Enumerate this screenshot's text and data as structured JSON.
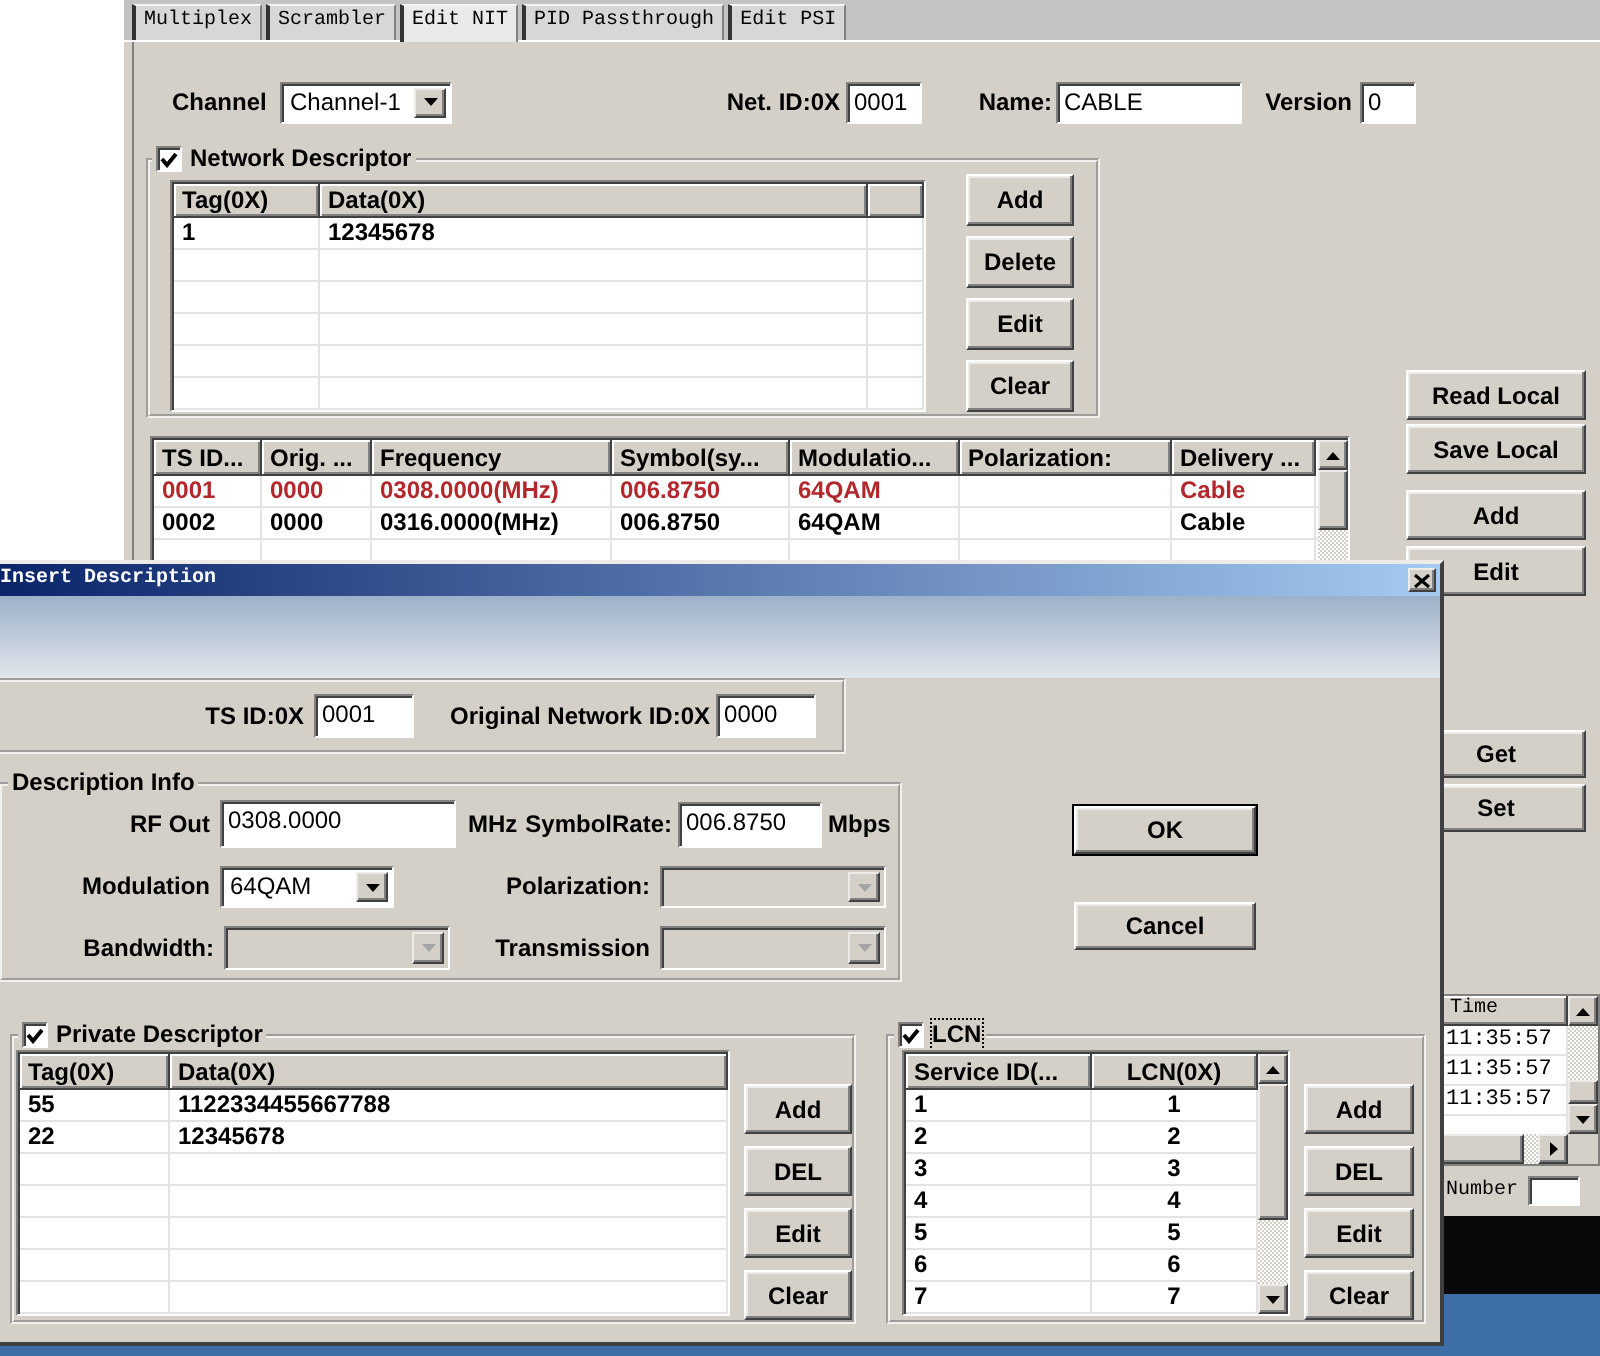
{
  "app": {
    "tabs": [
      {
        "label": "Multiplex",
        "selected": false
      },
      {
        "label": "Scrambler",
        "selected": false
      },
      {
        "label": "Edit NIT",
        "selected": true
      },
      {
        "label": "PID Passthrough",
        "selected": false
      },
      {
        "label": "Edit PSI",
        "selected": false
      }
    ],
    "channel": {
      "label": "Channel",
      "value": "Channel-1"
    },
    "net_id": {
      "label": "Net. ID:0X",
      "value": "0001"
    },
    "name": {
      "label": "Name:",
      "value": "CABLE"
    },
    "version": {
      "label": "Version",
      "value": "0"
    },
    "network_descriptor": {
      "title": "Network Descriptor",
      "checked": true,
      "columns": [
        "Tag(0X)",
        "Data(0X)"
      ],
      "rows": [
        [
          "1",
          "12345678"
        ]
      ],
      "buttons": [
        "Add",
        "Delete",
        "Edit",
        "Clear"
      ]
    },
    "ts_table": {
      "columns": {
        "ts_id": "TS ID...",
        "orig": "Orig. ...",
        "frequency": "Frequency",
        "symbol": "Symbol(sy...",
        "modulation": "Modulatio...",
        "polarization": "Polarization:",
        "delivery": "Delivery ..."
      },
      "rows": [
        {
          "selected": true,
          "cells": {
            "ts_id": "0001",
            "orig": "0000",
            "frequency": "0308.0000(MHz)",
            "symbol": "006.8750",
            "modulation": "64QAM",
            "delivery": "Cable"
          }
        },
        {
          "selected": false,
          "cells": {
            "ts_id": "0002",
            "orig": "0000",
            "frequency": "0316.0000(MHz)",
            "symbol": "006.8750",
            "modulation": "64QAM",
            "delivery": "Cable"
          }
        }
      ]
    },
    "side_buttons": [
      "Read Local",
      "Save Local",
      "Add",
      "Edit",
      "Get",
      "Set"
    ],
    "log_list": {
      "columns": [
        "Time"
      ],
      "rows": [
        [
          "11:35:57"
        ],
        [
          "11:35:57"
        ],
        [
          "11:35:57"
        ]
      ]
    },
    "number": {
      "label": "Number"
    }
  },
  "dialog": {
    "title": "Insert Description",
    "ts_id": {
      "label": "TS ID:0X",
      "value": "0001"
    },
    "original_network_id": {
      "label": "Original Network ID:0X",
      "value": "0000"
    },
    "description_info": {
      "title": "Description Info",
      "rf_out": {
        "label": "RF Out",
        "value": "0308.0000",
        "unit": "MHz"
      },
      "symbol_rate": {
        "label": "SymbolRate:",
        "value": "006.8750",
        "unit": "Mbps"
      },
      "modulation": {
        "label": "Modulation",
        "value": "64QAM",
        "disabled": false
      },
      "polarization": {
        "label": "Polarization:",
        "disabled": true
      },
      "bandwidth": {
        "label": "Bandwidth:",
        "disabled": true
      },
      "transmission": {
        "label": "Transmission",
        "disabled": true
      }
    },
    "buttons": [
      {
        "label": "OK",
        "default": true
      },
      {
        "label": "Cancel",
        "default": false
      }
    ],
    "private_descriptor": {
      "title": "Private Descriptor",
      "checked": true,
      "columns": [
        "Tag(0X)",
        "Data(0X)"
      ],
      "rows": [
        [
          "55",
          "1122334455667788"
        ],
        [
          "22",
          "12345678"
        ]
      ],
      "buttons": [
        "Add",
        "DEL",
        "Edit",
        "Clear"
      ]
    },
    "lcn": {
      "title": "LCN",
      "checked": true,
      "focused": true,
      "columns": [
        "Service ID(...",
        "LCN(0X)"
      ],
      "rows": [
        [
          "1",
          "1"
        ],
        [
          "2",
          "2"
        ],
        [
          "3",
          "3"
        ],
        [
          "4",
          "4"
        ],
        [
          "5",
          "5"
        ],
        [
          "6",
          "6"
        ],
        [
          "7",
          "7"
        ]
      ],
      "buttons": [
        "Add",
        "DEL",
        "Edit",
        "Clear"
      ]
    }
  }
}
